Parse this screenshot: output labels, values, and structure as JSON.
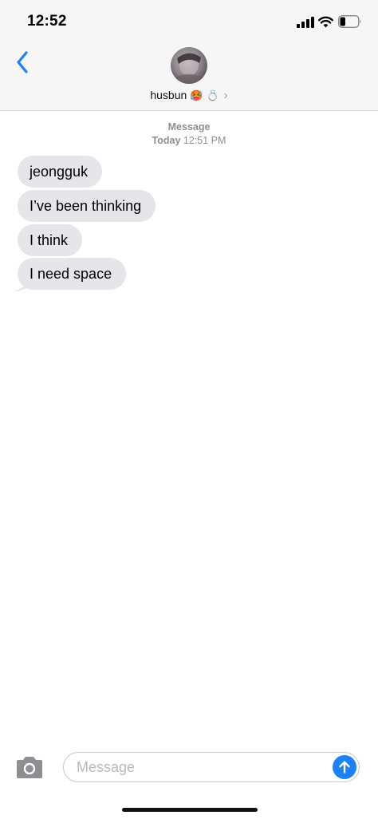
{
  "status_bar": {
    "time": "12:52",
    "signal_icon": "cellular-signal-icon",
    "wifi_icon": "wifi-icon",
    "battery_icon": "battery-icon",
    "battery_level": 0.3
  },
  "nav": {
    "back_icon": "chevron-left-icon",
    "contact": {
      "name": "husbun",
      "emoji_1": "🥵",
      "emoji_2": "💍",
      "chevron": "›"
    }
  },
  "conversation": {
    "service_label": "Message",
    "timestamp_day": "Today",
    "timestamp_time": "12:51 PM",
    "messages": [
      {
        "text": "jeongguk",
        "direction": "incoming"
      },
      {
        "text": "I’ve been thinking",
        "direction": "incoming"
      },
      {
        "text": "I think",
        "direction": "incoming"
      },
      {
        "text": "I need space",
        "direction": "incoming"
      }
    ]
  },
  "input_bar": {
    "camera_icon": "camera-icon",
    "placeholder": "Message",
    "send_icon": "arrow-up-icon"
  },
  "colors": {
    "accent": "#1a82fb",
    "incoming_bubble": "#e5e5ea",
    "header_bg": "#f6f6f6",
    "secondary_text": "#8e8e93"
  }
}
